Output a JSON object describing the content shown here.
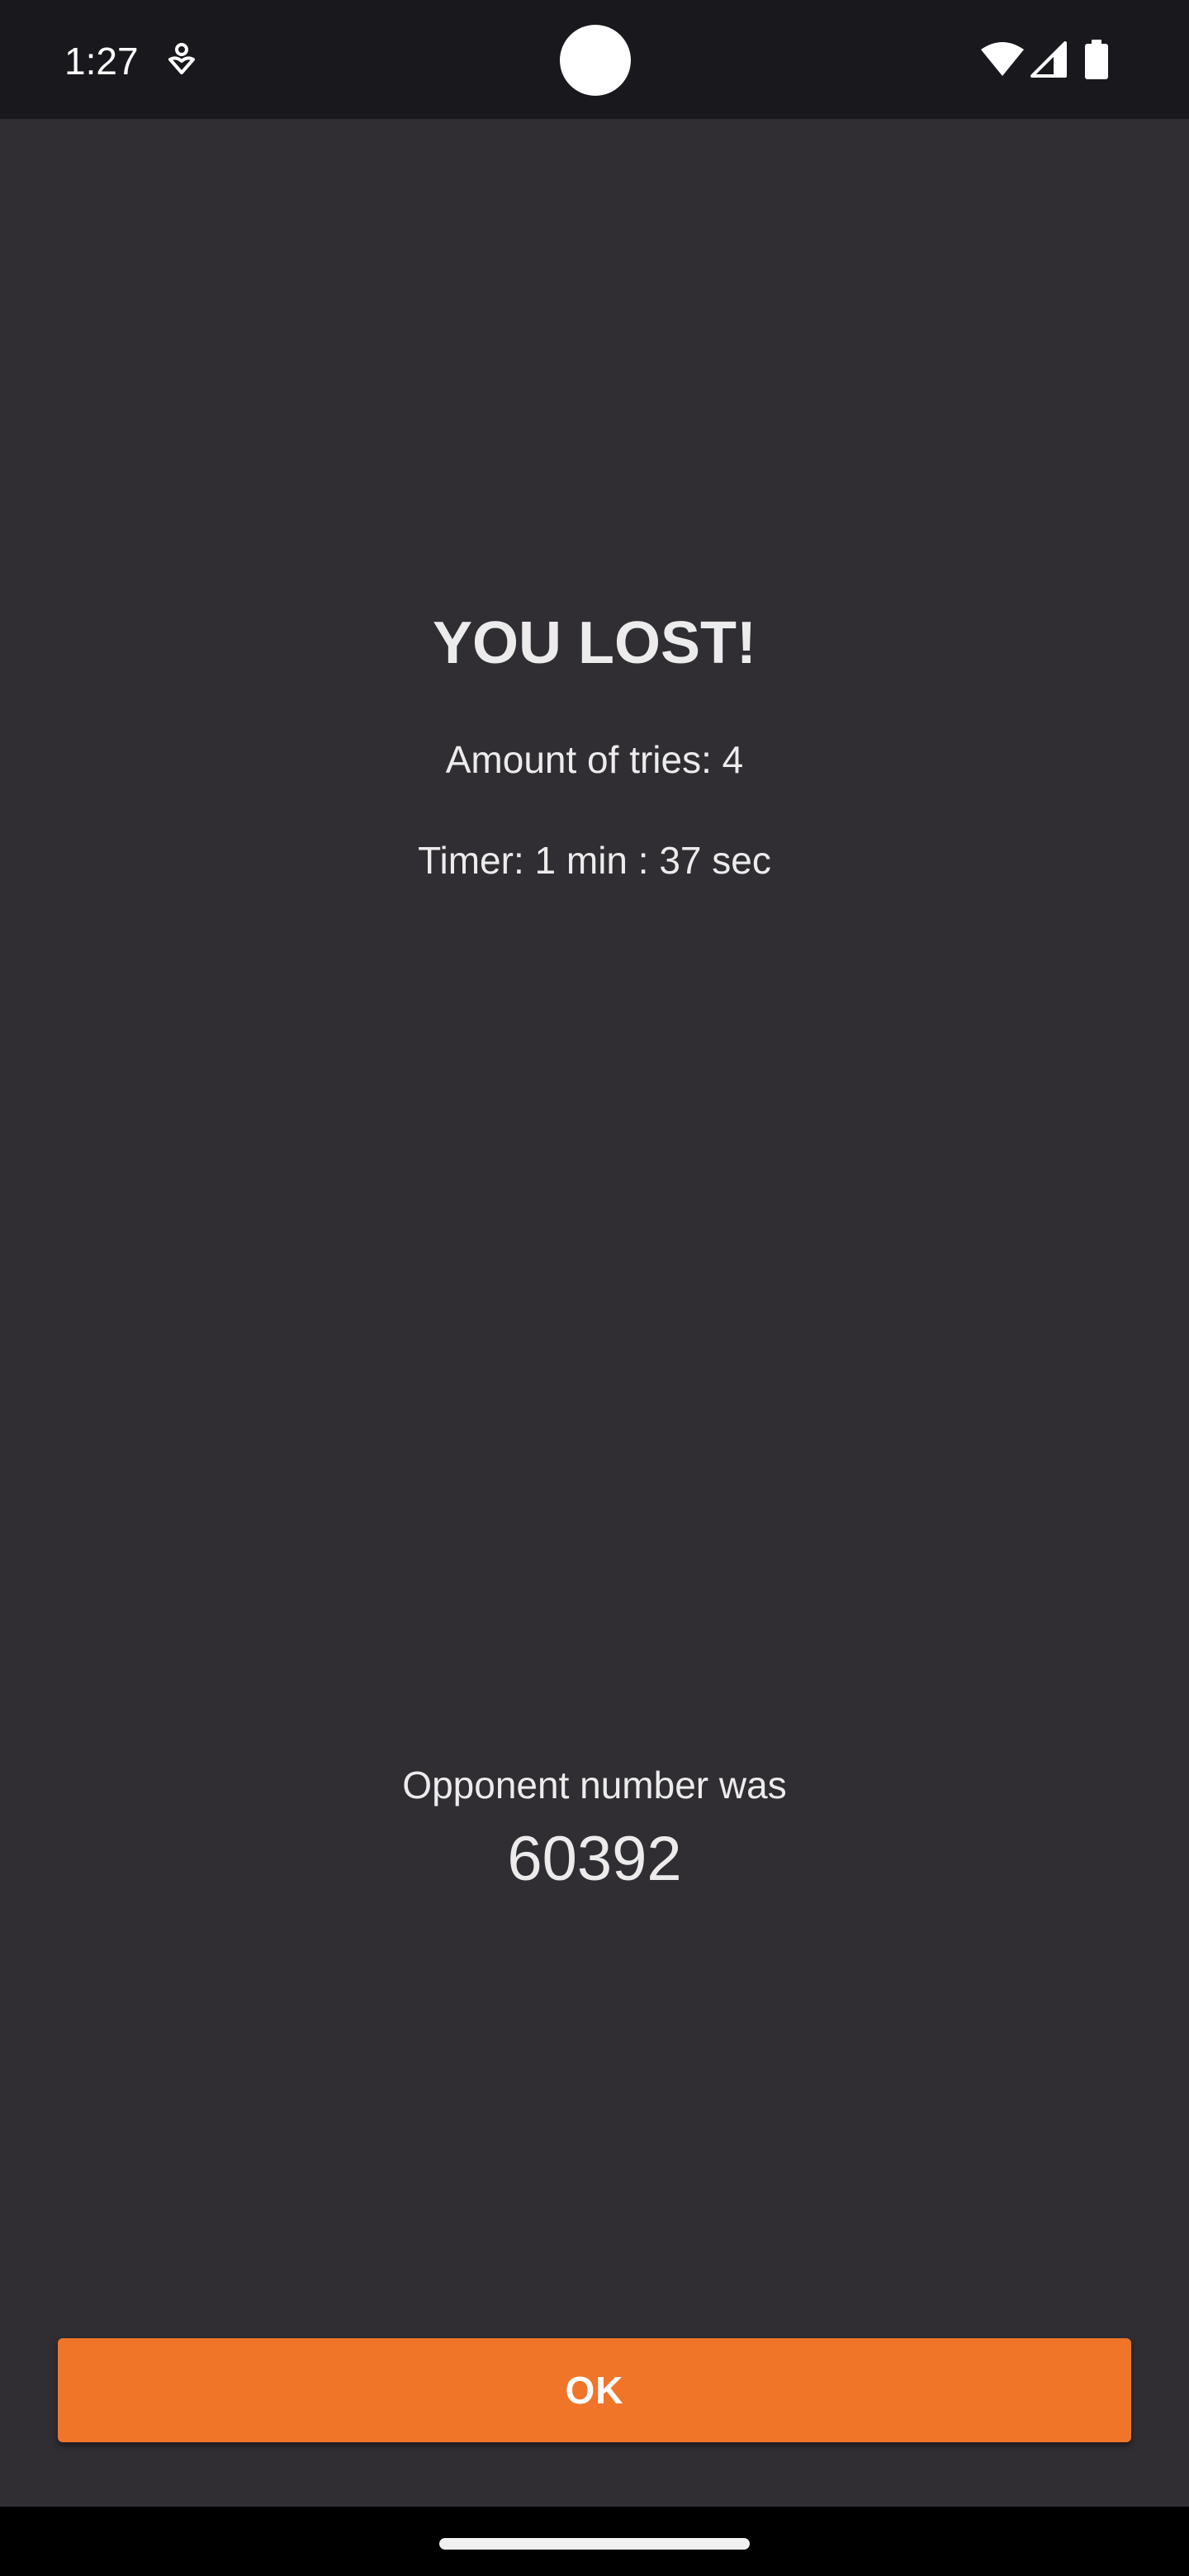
{
  "status_bar": {
    "time": "1:27",
    "icons": [
      "app-notification-icon",
      "wifi-icon",
      "signal-icon",
      "battery-icon"
    ]
  },
  "result": {
    "title": "YOU LOST!",
    "tries": "Amount of tries: 4",
    "timer": "Timer: 1 min : 37 sec"
  },
  "opponent": {
    "label": "Opponent number was",
    "number": "60392"
  },
  "actions": {
    "ok_label": "OK"
  },
  "colors": {
    "background": "#302e32",
    "status_bar": "#19181c",
    "accent": "#f07529",
    "text": "#ececec"
  }
}
